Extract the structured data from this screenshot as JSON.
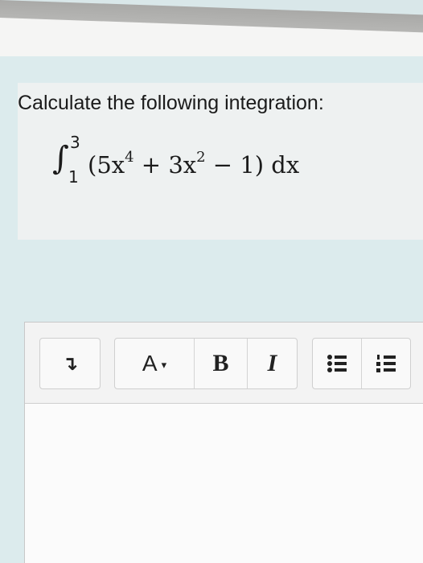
{
  "question": {
    "prompt": "Calculate the following integration:",
    "integral_sign": "∫",
    "upper_limit": "3",
    "lower_limit": "1",
    "integrand_part1": "(5x",
    "exponent1": "4",
    "integrand_part2": " + 3x",
    "exponent2": "2",
    "integrand_part3": " − 1) dx"
  },
  "toolbar": {
    "paragraph_icon": "↴",
    "font_color_label": "A",
    "font_color_caret": "▾",
    "bold_label": "B",
    "italic_label": "I",
    "bulleted_list_icon": "bulleted-list-icon",
    "numbered_list_icon": "numbered-list-icon"
  },
  "editor": {
    "content": ""
  },
  "colors": {
    "panel_background": "#dcebed",
    "question_background": "#eef1f1",
    "text": "#1b1b1b"
  }
}
